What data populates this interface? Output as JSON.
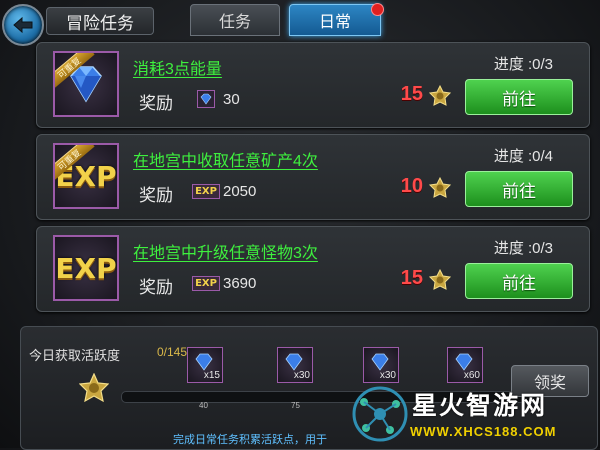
{
  "header": {
    "title": "冒险任务",
    "tabs": [
      {
        "label": "任务",
        "active": false
      },
      {
        "label": "日常",
        "active": true,
        "has_notification": true
      }
    ]
  },
  "tasks": [
    {
      "name": "消耗3点能量",
      "icon": "gem-icon",
      "repeatable_label": "可重复",
      "reward_label": "奖励",
      "reward_icon": "gem-small-icon",
      "reward_value": "30",
      "progress": "进度 :0/3",
      "points": "15",
      "button_label": "前往"
    },
    {
      "name": "在地宫中收取任意矿产4次",
      "icon": "exp-icon",
      "icon_text": "EXP",
      "repeatable_label": "可重复",
      "reward_label": "奖励",
      "reward_icon": "exp-small-icon",
      "reward_icon_text": "EXP",
      "reward_value": "2050",
      "progress": "进度 :0/4",
      "points": "10",
      "button_label": "前往"
    },
    {
      "name": "在地宫中升级任意怪物3次",
      "icon": "exp-icon",
      "icon_text": "EXP",
      "reward_label": "奖励",
      "reward_icon": "exp-small-icon",
      "reward_icon_text": "EXP",
      "reward_value": "3690",
      "progress": "进度 :0/3",
      "points": "15",
      "button_label": "前往"
    }
  ],
  "activity": {
    "label": "今日获取活跃度",
    "count": "0/145",
    "milestones": [
      {
        "count": "x15"
      },
      {
        "count": "x30"
      },
      {
        "count": "x30"
      },
      {
        "count": "x60"
      }
    ],
    "ticks": [
      "40",
      "75"
    ],
    "claim_label": "领奖",
    "footer": "完成日常任务积累活跃点，用于"
  },
  "watermark": {
    "title": "星火智游网",
    "url": "WWW.XHCS188.COM"
  },
  "colors": {
    "task_name": "#3ef03e",
    "points": "#ff4a4a",
    "go_button": "#2aa82a",
    "active_tab": "#1f73b0",
    "footer_text": "#5fc0ff",
    "watermark_url": "#f0d000"
  }
}
